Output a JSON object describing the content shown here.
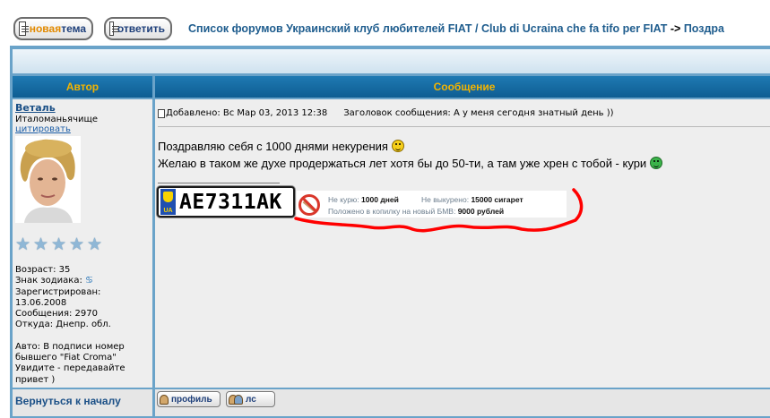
{
  "toolbar": {
    "new_topic_prefix": "новая",
    "new_topic_suffix": " тема",
    "reply_label": "ответить"
  },
  "breadcrumb": {
    "forum_index": "Список форумов Украинский клуб любителей FIAT / Club di Ucraina che fa tifo per FIAT",
    "separator": " -> ",
    "current": "Поздра"
  },
  "table_headers": {
    "author": "Автор",
    "message": "Сообщение"
  },
  "author": {
    "name": "Веталь",
    "rank": "Италоманьячище",
    "quote_link": "цитировать",
    "star_count": 5,
    "age": "Возраст: 35",
    "zodiac_label": "Знак зодиака:",
    "zodiac_symbol": "♋",
    "registered_label": "Зарегистрирован:",
    "registered_date": "13.06.2008",
    "posts": "Сообщения: 2970",
    "location": "Откуда: Днепр. обл.",
    "car_line1": "Авто: В подписи номер",
    "car_line2": "бывшего \"Fiat Croma\"",
    "car_line3": "Увидите - передавайте",
    "car_line4": "привет )"
  },
  "post": {
    "posted": "Добавлено: Вс Мар 03, 2013 12:38",
    "subject": "Заголовок сообщения: А у меня сегодня знатный день ))",
    "line1": "Поздравляю себя с 1000 днями некурения",
    "line2": "Желаю в таком же духе продержаться лет хотя бы до 50-ти, а там уже хрен с тобой - кури",
    "smiley1_icon": "smile-icon",
    "smiley2_icon": "grin-icon"
  },
  "signature": {
    "plate_country": "UA",
    "plate_number": "АЕ7311АК",
    "counter": {
      "not_smoking_label": "Не курю:",
      "not_smoking_value": "1000 дней",
      "not_smoked_label": "Не выкурено:",
      "not_smoked_value": "15000 сигарет",
      "savings_label": "Положено в копилку на новый БМВ:",
      "savings_value": "9000 рублей"
    },
    "annotation_color": "#ff0000"
  },
  "footer": {
    "back_to_top": "Вернуться к началу",
    "profile_label": "профиль",
    "pm_label": "лс"
  },
  "colors": {
    "header_bg": "#0e5d92",
    "header_text": "#f4b400",
    "frame": "#6aa3c9",
    "cell_bg": "#eeeeee",
    "link": "#1f5d8e"
  }
}
